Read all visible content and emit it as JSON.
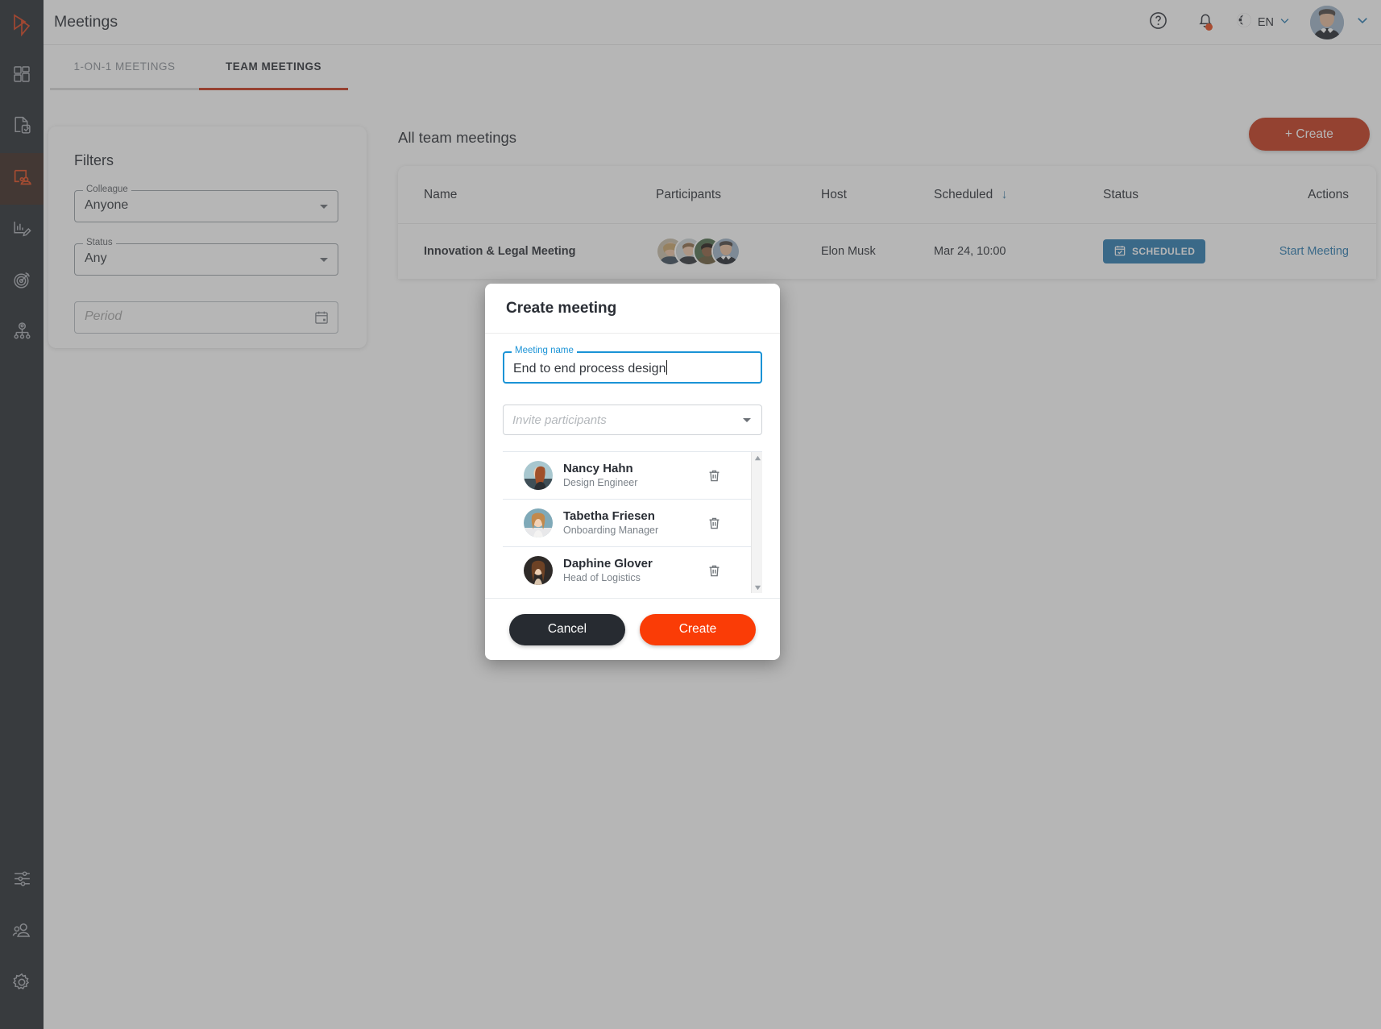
{
  "app": {
    "logo_icon": "brand-logo-icon",
    "accent_color": "#c5381b",
    "create_color": "#fa3c06",
    "link_color": "#2a7ab0"
  },
  "sidebar": {
    "items": [
      {
        "name": "dashboard",
        "icon": "grid-icon",
        "active": false
      },
      {
        "name": "documents",
        "icon": "document-check-icon",
        "active": false
      },
      {
        "name": "meetings",
        "icon": "meetings-icon",
        "active": true
      },
      {
        "name": "reviews",
        "icon": "chart-pen-icon",
        "active": false
      },
      {
        "name": "goals",
        "icon": "target-icon",
        "active": false
      },
      {
        "name": "org-chart",
        "icon": "org-chart-icon",
        "active": false
      }
    ],
    "bottom_items": [
      {
        "name": "preferences",
        "icon": "sliders-icon",
        "active": false
      },
      {
        "name": "people",
        "icon": "people-icon",
        "active": false
      },
      {
        "name": "settings",
        "icon": "gear-icon",
        "active": false
      }
    ]
  },
  "header": {
    "title": "Meetings",
    "help_icon": "question-circle-icon",
    "notifications_icon": "bell-icon",
    "has_notification": true,
    "language_icon": "globe-icon",
    "language": "EN",
    "chevron_icon": "chevron-down-icon",
    "avatar": "user-avatar"
  },
  "tabs": [
    {
      "label": "1-ON-1 MEETINGS",
      "active": false
    },
    {
      "label": "TEAM MEETINGS",
      "active": true
    }
  ],
  "filters": {
    "title": "Filters",
    "colleague": {
      "label": "Colleague",
      "value": "Anyone"
    },
    "status": {
      "label": "Status",
      "value": "Any"
    },
    "period": {
      "placeholder": "Period",
      "value": "",
      "icon": "calendar-icon"
    }
  },
  "list": {
    "title": "All team meetings",
    "create_button": "+ Create",
    "columns": [
      "Name",
      "Participants",
      "Host",
      "Scheduled",
      "Status",
      "Actions"
    ],
    "sorted_column": "Scheduled",
    "sort_direction": "desc",
    "rows": [
      {
        "name": "Innovation & Legal Meeting",
        "participant_count": 4,
        "host": "Elon Musk",
        "scheduled": "Mar 24, 10:00",
        "status": "SCHEDULED",
        "status_icon": "calendar-check-icon",
        "action": "Start Meeting"
      }
    ]
  },
  "modal": {
    "title": "Create meeting",
    "meeting_name": {
      "label": "Meeting name",
      "value": "End to end process design"
    },
    "invite": {
      "placeholder": "Invite participants",
      "value": ""
    },
    "participants": [
      {
        "name": "Nancy Hahn",
        "role": "Design Engineer",
        "remove_icon": "trash-icon"
      },
      {
        "name": "Tabetha Friesen",
        "role": "Onboarding Manager",
        "remove_icon": "trash-icon"
      },
      {
        "name": "Daphine Glover",
        "role": "Head of Logistics",
        "remove_icon": "trash-icon"
      }
    ],
    "cancel_button": "Cancel",
    "create_button": "Create"
  }
}
